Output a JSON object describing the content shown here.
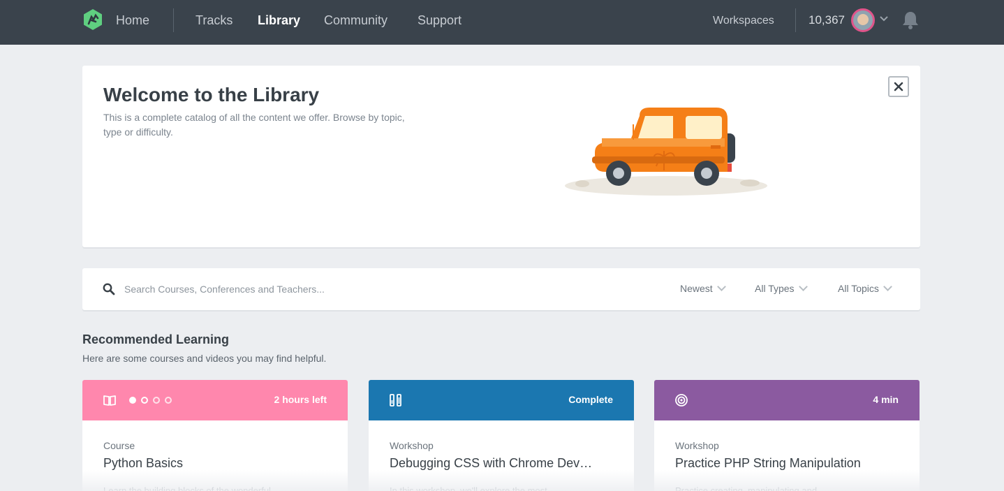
{
  "nav": {
    "home": "Home",
    "tracks": "Tracks",
    "library": "Library",
    "community": "Community",
    "support": "Support",
    "workspaces": "Workspaces",
    "points": "10,367"
  },
  "welcome": {
    "title": "Welcome to the Library",
    "text": "This is a complete catalog of all the content we offer. Browse by topic, type or difficulty."
  },
  "search": {
    "placeholder": "Search Courses, Conferences and Teachers...",
    "sort": "Newest",
    "types": "All Types",
    "topics": "All Topics"
  },
  "recommended": {
    "title": "Recommended Learning",
    "subtitle": "Here are some courses and videos you may find helpful.",
    "cards": [
      {
        "color": "#ff87ad",
        "icon": "book-icon",
        "meta": "2 hours left",
        "type": "Course",
        "title": "Python Basics",
        "desc": "Learn the building blocks of the wonderful"
      },
      {
        "color": "#1b77b0",
        "icon": "workshop-icon",
        "meta": "Complete",
        "type": "Workshop",
        "title": "Debugging CSS with Chrome Dev…",
        "desc": "In this workshop, we'll explore the most"
      },
      {
        "color": "#8b5aa0",
        "icon": "target-icon",
        "meta": "4 min",
        "type": "Workshop",
        "title": "Practice PHP String Manipulation",
        "desc": "Practice creating, manipulating and"
      }
    ]
  },
  "colors": {
    "nav_bg": "#3a434c",
    "page_bg": "#eceef1",
    "brand": "#5fcf80"
  }
}
